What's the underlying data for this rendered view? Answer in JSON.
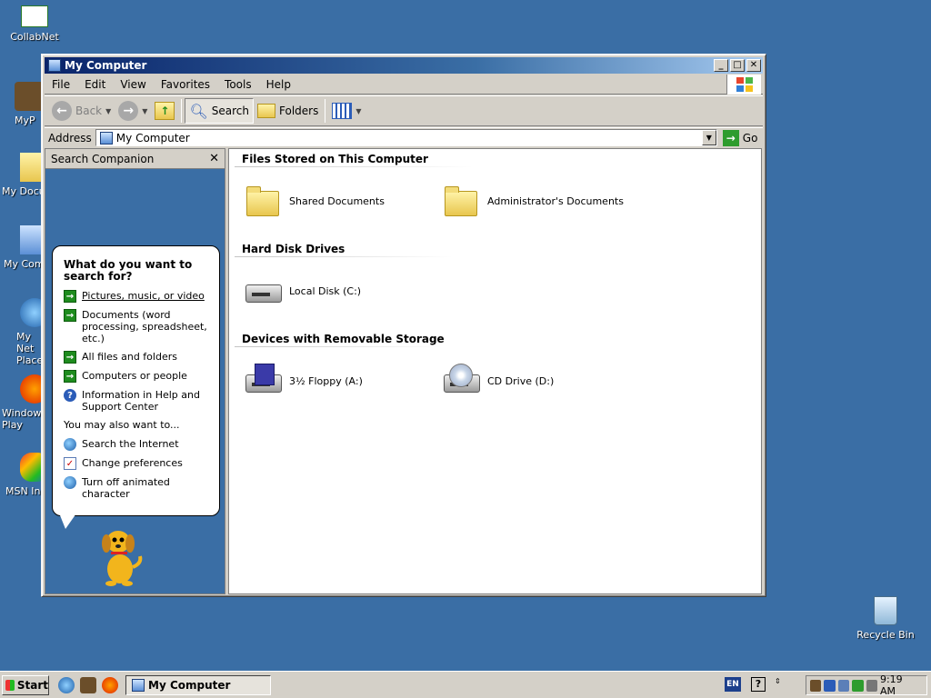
{
  "desktop": {
    "icons": [
      {
        "label": "CollabNet"
      },
      {
        "label": "MyP"
      },
      {
        "label": "My Docu"
      },
      {
        "label": "My Com"
      },
      {
        "label": "My Net Place"
      },
      {
        "label": "Windows Play"
      },
      {
        "label": "MSN Ins"
      },
      {
        "label": "Recycle Bin"
      }
    ]
  },
  "window": {
    "title": "My Computer",
    "menu": [
      "File",
      "Edit",
      "View",
      "Favorites",
      "Tools",
      "Help"
    ],
    "toolbar": {
      "back": "Back",
      "search": "Search",
      "folders": "Folders"
    },
    "address": {
      "label": "Address",
      "value": "My Computer",
      "go": "Go"
    }
  },
  "companion": {
    "title": "Search Companion",
    "close": "✕",
    "question": "What do you want to search for?",
    "options": [
      {
        "text": "Pictures, music, or video",
        "icon": "arrow-icon"
      },
      {
        "text": "Documents (word processing, spreadsheet, etc.)",
        "icon": "arrow-icon"
      },
      {
        "text": "All files and folders",
        "icon": "arrow-icon"
      },
      {
        "text": "Computers or people",
        "icon": "arrow-icon"
      },
      {
        "text": "Information in Help and Support Center",
        "icon": "help-icon"
      }
    ],
    "also_label": "You may also want to...",
    "also_options": [
      {
        "text": "Search the Internet",
        "icon": "search-internet-icon"
      },
      {
        "text": "Change preferences",
        "icon": "preferences-icon"
      },
      {
        "text": "Turn off animated character",
        "icon": "globe-icon"
      }
    ]
  },
  "content": {
    "sections": [
      {
        "title": "Files Stored on This Computer",
        "items": [
          "Shared Documents",
          "Administrator's Documents"
        ]
      },
      {
        "title": "Hard Disk Drives",
        "items": [
          "Local Disk (C:)"
        ]
      },
      {
        "title": "Devices with Removable Storage",
        "items": [
          "3½ Floppy (A:)",
          "CD Drive (D:)"
        ]
      }
    ]
  },
  "taskbar": {
    "start": "Start",
    "task": "My Computer",
    "lang": "EN",
    "help": "?",
    "clock": "9:19 AM"
  },
  "colors": {
    "desktop": "#3a6ea5",
    "titlebar": "#0a246a",
    "chrome": "#d4d0c8"
  }
}
